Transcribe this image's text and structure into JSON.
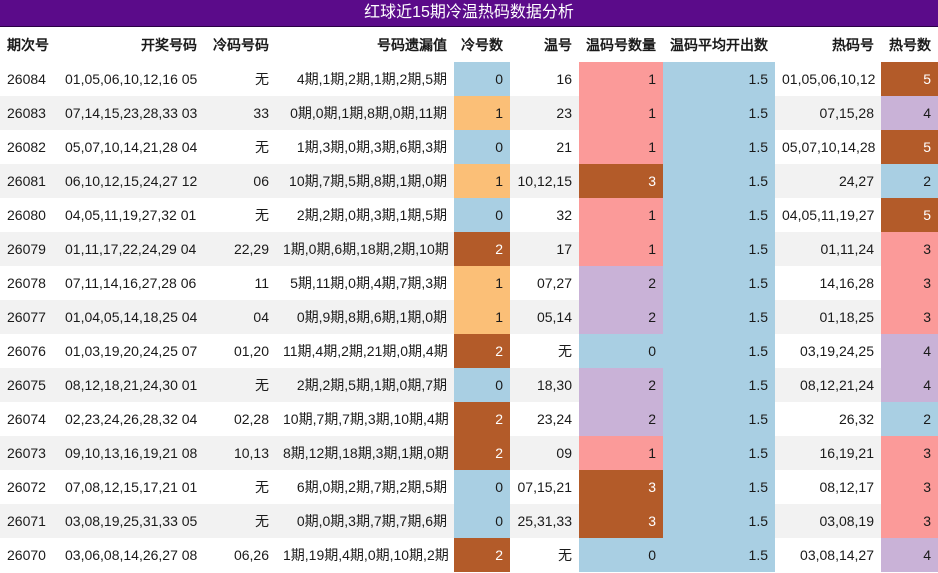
{
  "title": "红球近15期冷温热码数据分析",
  "headers": [
    "期次号",
    "开奖号码",
    "冷码号码",
    "号码遗漏值",
    "冷号数",
    "温号",
    "温码号数量",
    "温码平均开出数",
    "热码号",
    "热号数"
  ],
  "colors": {
    "title_bg": "#5b0b8a",
    "blue": "#a9cfe3",
    "orange": "#fbbf77",
    "brown": "#b35b29",
    "pink": "#fb9a99",
    "purple": "#c9b2d7"
  },
  "rows": [
    {
      "issue": "26084",
      "draw": "01,05,06,10,12,16 05",
      "cold_nums": "无",
      "omission": "4期,1期,2期,1期,2期,5期",
      "cold_count": "0",
      "warm_nums": "16",
      "warm_count": "1",
      "warm_avg": "1.5",
      "hot_nums": "01,05,06,10,12",
      "hot_count": "5"
    },
    {
      "issue": "26083",
      "draw": "07,14,15,23,28,33 03",
      "cold_nums": "33",
      "omission": "0期,0期,1期,8期,0期,11期",
      "cold_count": "1",
      "warm_nums": "23",
      "warm_count": "1",
      "warm_avg": "1.5",
      "hot_nums": "07,15,28",
      "hot_count": "4"
    },
    {
      "issue": "26082",
      "draw": "05,07,10,14,21,28 04",
      "cold_nums": "无",
      "omission": "1期,3期,0期,3期,6期,3期",
      "cold_count": "0",
      "warm_nums": "21",
      "warm_count": "1",
      "warm_avg": "1.5",
      "hot_nums": "05,07,10,14,28",
      "hot_count": "5"
    },
    {
      "issue": "26081",
      "draw": "06,10,12,15,24,27 12",
      "cold_nums": "06",
      "omission": "10期,7期,5期,8期,1期,0期",
      "cold_count": "1",
      "warm_nums": "10,12,15",
      "warm_count": "3",
      "warm_avg": "1.5",
      "hot_nums": "24,27",
      "hot_count": "2"
    },
    {
      "issue": "26080",
      "draw": "04,05,11,19,27,32 01",
      "cold_nums": "无",
      "omission": "2期,2期,0期,3期,1期,5期",
      "cold_count": "0",
      "warm_nums": "32",
      "warm_count": "1",
      "warm_avg": "1.5",
      "hot_nums": "04,05,11,19,27",
      "hot_count": "5"
    },
    {
      "issue": "26079",
      "draw": "01,11,17,22,24,29 04",
      "cold_nums": "22,29",
      "omission": "1期,0期,6期,18期,2期,10期",
      "cold_count": "2",
      "warm_nums": "17",
      "warm_count": "1",
      "warm_avg": "1.5",
      "hot_nums": "01,11,24",
      "hot_count": "3"
    },
    {
      "issue": "26078",
      "draw": "07,11,14,16,27,28 06",
      "cold_nums": "11",
      "omission": "5期,11期,0期,4期,7期,3期",
      "cold_count": "1",
      "warm_nums": "07,27",
      "warm_count": "2",
      "warm_avg": "1.5",
      "hot_nums": "14,16,28",
      "hot_count": "3"
    },
    {
      "issue": "26077",
      "draw": "01,04,05,14,18,25 04",
      "cold_nums": "04",
      "omission": "0期,9期,8期,6期,1期,0期",
      "cold_count": "1",
      "warm_nums": "05,14",
      "warm_count": "2",
      "warm_avg": "1.5",
      "hot_nums": "01,18,25",
      "hot_count": "3"
    },
    {
      "issue": "26076",
      "draw": "01,03,19,20,24,25 07",
      "cold_nums": "01,20",
      "omission": "11期,4期,2期,21期,0期,4期",
      "cold_count": "2",
      "warm_nums": "无",
      "warm_count": "0",
      "warm_avg": "1.5",
      "hot_nums": "03,19,24,25",
      "hot_count": "4"
    },
    {
      "issue": "26075",
      "draw": "08,12,18,21,24,30 01",
      "cold_nums": "无",
      "omission": "2期,2期,5期,1期,0期,7期",
      "cold_count": "0",
      "warm_nums": "18,30",
      "warm_count": "2",
      "warm_avg": "1.5",
      "hot_nums": "08,12,21,24",
      "hot_count": "4"
    },
    {
      "issue": "26074",
      "draw": "02,23,24,26,28,32 04",
      "cold_nums": "02,28",
      "omission": "10期,7期,7期,3期,10期,4期",
      "cold_count": "2",
      "warm_nums": "23,24",
      "warm_count": "2",
      "warm_avg": "1.5",
      "hot_nums": "26,32",
      "hot_count": "2"
    },
    {
      "issue": "26073",
      "draw": "09,10,13,16,19,21 08",
      "cold_nums": "10,13",
      "omission": "8期,12期,18期,3期,1期,0期",
      "cold_count": "2",
      "warm_nums": "09",
      "warm_count": "1",
      "warm_avg": "1.5",
      "hot_nums": "16,19,21",
      "hot_count": "3"
    },
    {
      "issue": "26072",
      "draw": "07,08,12,15,17,21 01",
      "cold_nums": "无",
      "omission": "6期,0期,2期,7期,2期,5期",
      "cold_count": "0",
      "warm_nums": "07,15,21",
      "warm_count": "3",
      "warm_avg": "1.5",
      "hot_nums": "08,12,17",
      "hot_count": "3"
    },
    {
      "issue": "26071",
      "draw": "03,08,19,25,31,33 05",
      "cold_nums": "无",
      "omission": "0期,0期,3期,7期,7期,6期",
      "cold_count": "0",
      "warm_nums": "25,31,33",
      "warm_count": "3",
      "warm_avg": "1.5",
      "hot_nums": "03,08,19",
      "hot_count": "3"
    },
    {
      "issue": "26070",
      "draw": "03,06,08,14,26,27 08",
      "cold_nums": "06,26",
      "omission": "1期,19期,4期,0期,10期,2期",
      "cold_count": "2",
      "warm_nums": "无",
      "warm_count": "0",
      "warm_avg": "1.5",
      "hot_nums": "03,08,14,27",
      "hot_count": "4"
    }
  ]
}
